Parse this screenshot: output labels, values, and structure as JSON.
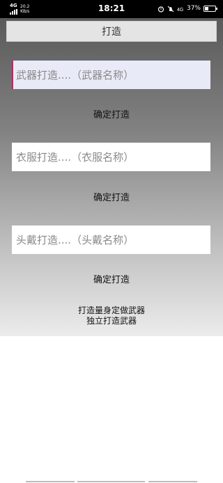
{
  "status_bar": {
    "network_type": "4G",
    "net_speed": "20.2",
    "net_speed_unit": "KB/s",
    "time": "18:21",
    "battery_level": "37%",
    "battery_fraction": 0.37,
    "icons": [
      "signal-icon",
      "alarm-icon",
      "do-not-disturb-icon",
      "4g-icon",
      "battery-icon"
    ]
  },
  "header": {
    "title": "打造"
  },
  "weapon": {
    "placeholder": "武器打造....（武器名称）",
    "confirm_label": "确定打造"
  },
  "clothes": {
    "placeholder": "衣服打造....（衣服名称）",
    "confirm_label": "确定打造"
  },
  "helmet": {
    "placeholder": "头戴打造....（头戴名称）",
    "confirm_label": "确定打造"
  },
  "footer": {
    "line1": "打造量身定做武器",
    "line2": "独立打造武器"
  }
}
